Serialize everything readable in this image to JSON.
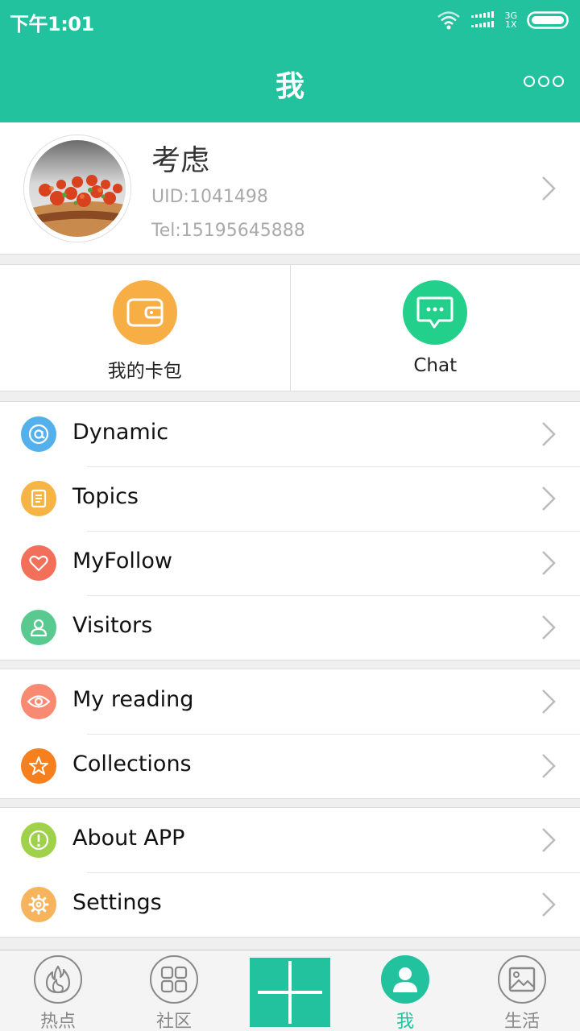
{
  "status_bar": {
    "time": "下午1:01",
    "network_top": "3G",
    "network_bottom": "1X"
  },
  "header": {
    "title": "我"
  },
  "profile": {
    "name": "考虑",
    "uid": "UID:1041498",
    "tel": "Tel:15195645888"
  },
  "quick_actions": [
    {
      "label": "我的卡包",
      "icon": "wallet-icon",
      "color": "#f6ae45"
    },
    {
      "label": "Chat",
      "icon": "chat-bubble-icon",
      "color": "#22d08b"
    }
  ],
  "groups": [
    {
      "items": [
        {
          "label": "Dynamic",
          "icon": "at-sign-icon",
          "color": "#54b0ea"
        },
        {
          "label": "Topics",
          "icon": "document-icon",
          "color": "#f6b445"
        },
        {
          "label": "MyFollow",
          "icon": "heart-icon",
          "color": "#f2705a"
        },
        {
          "label": "Visitors",
          "icon": "person-icon",
          "color": "#59c98f"
        }
      ]
    },
    {
      "items": [
        {
          "label": "My reading",
          "icon": "eye-icon",
          "color": "#f98a72"
        },
        {
          "label": "Collections",
          "icon": "star-icon",
          "color": "#f6801e"
        }
      ]
    },
    {
      "items": [
        {
          "label": "About APP",
          "icon": "info-icon",
          "color": "#9fd14a"
        },
        {
          "label": "Settings",
          "icon": "gear-icon",
          "color": "#f6b45e"
        }
      ]
    }
  ],
  "tab_bar": {
    "tabs": [
      {
        "label": "热点",
        "icon": "flame-icon"
      },
      {
        "label": "社区",
        "icon": "grid-icon"
      },
      {
        "label": "我",
        "icon": "user-icon",
        "active": true
      },
      {
        "label": "生活",
        "icon": "picture-icon"
      }
    ],
    "center_button": "plus-icon"
  },
  "colors": {
    "accent": "#22c29f",
    "background": "#efefef"
  }
}
